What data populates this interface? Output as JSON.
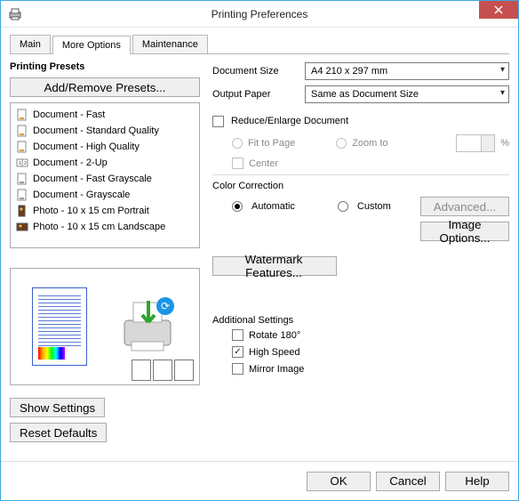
{
  "window": {
    "title": "Printing Preferences"
  },
  "tabs": {
    "main": "Main",
    "more": "More Options",
    "maint": "Maintenance",
    "active": "more"
  },
  "left": {
    "heading": "Printing Presets",
    "addremove": "Add/Remove Presets...",
    "items": [
      "Document - Fast",
      "Document - Standard Quality",
      "Document - High Quality",
      "Document - 2-Up",
      "Document - Fast Grayscale",
      "Document - Grayscale",
      "Photo - 10 x 15 cm Portrait",
      "Photo - 10 x 15 cm Landscape"
    ],
    "show_settings": "Show Settings",
    "reset_defaults": "Reset Defaults"
  },
  "right": {
    "doc_size_lbl": "Document Size",
    "doc_size_val": "A4 210 x 297 mm",
    "out_paper_lbl": "Output Paper",
    "out_paper_val": "Same as Document Size",
    "reduce_enlarge": "Reduce/Enlarge Document",
    "fit_to_page": "Fit to Page",
    "zoom_to": "Zoom to",
    "percent": "%",
    "center": "Center",
    "color_corr": "Color Correction",
    "automatic": "Automatic",
    "custom": "Custom",
    "advanced": "Advanced...",
    "image_options": "Image Options...",
    "watermark": "Watermark Features...",
    "additional": "Additional Settings",
    "rotate180": "Rotate 180°",
    "high_speed": "High Speed",
    "mirror": "Mirror Image"
  },
  "footer": {
    "ok": "OK",
    "cancel": "Cancel",
    "help": "Help"
  },
  "state": {
    "reduce_enlarge_checked": false,
    "high_speed_checked": true,
    "rotate180_checked": false,
    "mirror_checked": false,
    "color_mode": "automatic"
  }
}
